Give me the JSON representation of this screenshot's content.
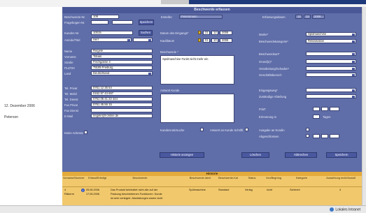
{
  "window": {
    "title": "Beschwerde erfassen"
  },
  "left": {
    "date": "12. Dezember 2006",
    "user": "Peterson"
  },
  "header": {
    "beschwerde_nr_label": "Beschwerde-Nr.",
    "beschwerde_nr_value": "109",
    "fragebogen_label": "Fragebogen-Nr.",
    "ersteller_label": "Ersteller:",
    "ersteller_value": "Petersmann",
    "erfassungsdatum_label": "Erfassungsdatum",
    "erfassungsdatum_value": [
      "12",
      "12",
      "2006"
    ],
    "speichern_label": "Speichern"
  },
  "customer": {
    "kundennr_label": "Kunden-Nr.",
    "kundennr_value": "10015",
    "suchen_label": "Suchen",
    "anrede_label": "Anrede/Titel",
    "anrede_value": "Herr",
    "name_label": "Name",
    "name_value": "Riegele",
    "vorname_label": "Vorname",
    "vorname_value": "Tobias",
    "strasse_label": "Straße",
    "strasse_value": "Fischgasse 3",
    "plz_label": "PLZ/Ort",
    "plz_value": "79195 Freiburg",
    "land_label": "Land",
    "land_value": "Deutschland",
    "tel_p_label": "Tel. Privat",
    "tel_p_value": "0761 12 35 54",
    "tel_m_label": "Tel. Mobil",
    "tel_m_value": "0152 87 43 667",
    "tel_d_label": "Tel. Dienst",
    "tel_d_value": "0761 05 41 22 444",
    "fax_p_label": "Fax Privat",
    "fax_p_value": "0761 45 56 15",
    "fax_d_label": "Fax Dienst",
    "email_label": "E-Mail",
    "email_value": "riegele@t-online.de",
    "keine_adr_label": "Keine Adresse"
  },
  "center": {
    "eingang_label": "Datum des Eingangs*",
    "eingang_value": [
      "21",
      "12",
      "2006"
    ],
    "kaufdatum_label": "Kaufdatum",
    "kaufdatum_value": [
      "01",
      "10",
      "2006"
    ],
    "beschwerde_label": "Beschwerde *",
    "beschwerde_text": "Spülmaschine Funkt nicht mehr ein",
    "antwort_label": "Antwort Kunde",
    "kundennotiz_label": "Kundennotizsuche",
    "antwort_schrift_label": "Antwort an Kunde Schriftl."
  },
  "right": {
    "marke_label": "Marke*",
    "marke_value": "Spülmaschine",
    "beschwerdekat_label": "Beschwerdekategorie*",
    "beschwerdekat_value": "Reklamation",
    "beschwerdeart_label": "Beschwerdeart*",
    "grund_label": "Grund(e)*",
    "verarbeitung_label": "Verarbeitung/Schaden*",
    "geschaeftsbereich_label": "Geschäftsbereich",
    "eingangsweg_label": "Eingangsweg*",
    "abteilung_label": "Zuständige Abteilung",
    "frist_label": "Frist*",
    "erinnerung_label": "Erinnerung in",
    "tagen_label": "Tagen",
    "ausgabe_label": "Ausgabe an Kundin",
    "abgeschlossen_label": "Abgeschlossen"
  },
  "actions": {
    "historie": "Historie anzeigen",
    "loeschen": "Löschen",
    "abbrechen": "Abbrechen",
    "speichern": "Speichern"
  },
  "history": {
    "title": "Historie",
    "headers": [
      "Vorname/Nummer",
      "Erfasst/Erledigt",
      "Beschwerde",
      "Beschwerde-Ident",
      "Beschwerde-Kat",
      "Status",
      "Von/Begrüng",
      "Kategorie",
      "Auswirkung recht/Anwalt"
    ],
    "rows": [
      [
        "4",
        "05.06.2006",
        "Das Produkt beinhaltet nicht alle auf der",
        "Spülmaschine",
        "Standard",
        "Verlag",
        "nicht",
        "Schlecht",
        "4"
      ],
      [
        "Rikkerm",
        "17.06.2006",
        "Packung beschriebenen Funktionen. Kunde",
        "",
        "",
        "",
        "",
        "",
        ""
      ],
      [
        "",
        "",
        "ist sehr verärgert. Abwicklungen waren nicht",
        "",
        "",
        "",
        "",
        "",
        ""
      ]
    ]
  },
  "status": {
    "zone": "Lokales Intranet"
  }
}
